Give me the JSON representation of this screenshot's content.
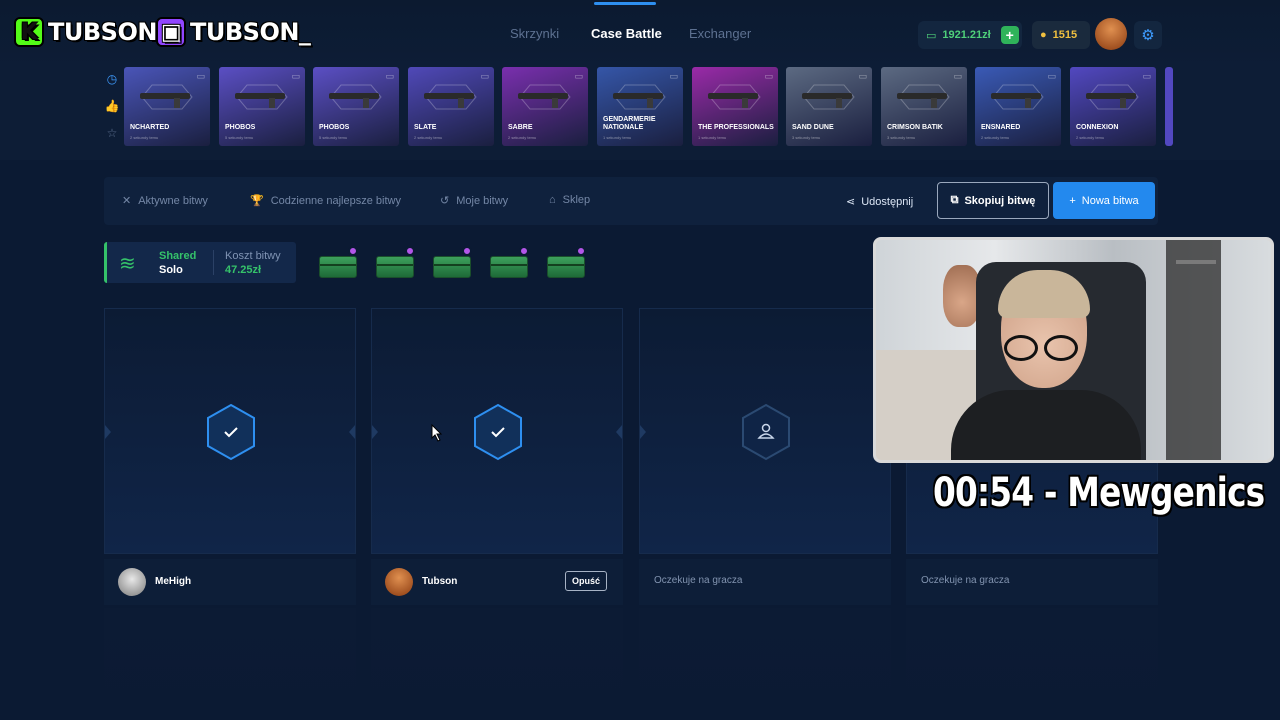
{
  "overlay": {
    "kick_handle": "TUBSON",
    "twitch_handle": "TUBSON_",
    "timer_text": "00:54 - Mewgenics"
  },
  "header": {
    "nav": [
      {
        "label": "Skrzynki",
        "active": false
      },
      {
        "label": "Case Battle",
        "active": true
      },
      {
        "label": "Exchanger",
        "active": false
      }
    ],
    "balance": "1921.21zł",
    "coins": "1515",
    "icons": {
      "wallet": "wallet-icon",
      "add": "plus-icon",
      "coin": "coin-icon",
      "settings": "gear-icon"
    }
  },
  "drops": {
    "filter_icons": [
      "clock-icon",
      "thumbs-up-icon",
      "star-icon"
    ],
    "items": [
      {
        "name": "NCHARTED",
        "sub": "2 sekundy temu",
        "color": "#4a55b8"
      },
      {
        "name": "PHOBOS",
        "sub": "5 sekundy temu",
        "color": "#5b4fc4"
      },
      {
        "name": "PHOBOS",
        "sub": "5 sekundy temu",
        "color": "#5b4fc4"
      },
      {
        "name": "SLATE",
        "sub": "2 sekundy temu",
        "color": "#5049b8"
      },
      {
        "name": "SABRE",
        "sub": "2 sekundy temu",
        "color": "#7a2fae"
      },
      {
        "name": "GENDARMERIE NATIONALE",
        "sub": "1 sekundy temu",
        "color": "#3556a8"
      },
      {
        "name": "THE PROFESSIONALS",
        "sub": "1 sekundy temu",
        "color": "#9a2aa8"
      },
      {
        "name": "SAND DUNE",
        "sub": "3 sekundy temu",
        "color": "#5c6a82"
      },
      {
        "name": "CRIMSON BATIK",
        "sub": "3 sekundy temu",
        "color": "#5c6a82"
      },
      {
        "name": "ENSNARED",
        "sub": "2 sekundy temu",
        "color": "#3a5ab6"
      },
      {
        "name": "CONNEXION",
        "sub": "2 sekundy temu",
        "color": "#5248c0"
      }
    ]
  },
  "filterbar": {
    "tabs": [
      {
        "label": "Aktywne bitwy",
        "icon": "swords-icon"
      },
      {
        "label": "Codzienne najlepsze bitwy",
        "icon": "trophy-icon"
      },
      {
        "label": "Moje bitwy",
        "icon": "history-icon"
      },
      {
        "label": "Sklep",
        "icon": "basket-icon"
      }
    ],
    "share_label": "Udostępnij",
    "copy_label": "Skopiuj bitwę",
    "new_label": "Nowa bitwa"
  },
  "battle": {
    "mode_line1": "Shared",
    "mode_line2": "Solo",
    "cost_label": "Koszt bitwy",
    "cost_value": "47.25zł",
    "case_count": 5
  },
  "players": [
    {
      "state": "ready",
      "name": "MeHigh",
      "wait": "",
      "leave": ""
    },
    {
      "state": "ready",
      "name": "Tubson",
      "wait": "",
      "leave": "Opuść"
    },
    {
      "state": "empty",
      "name": "",
      "wait": "Oczekuje na gracza",
      "leave": ""
    },
    {
      "state": "empty",
      "name": "",
      "wait": "Oczekuje na gracza",
      "leave": ""
    }
  ],
  "colors": {
    "background": "#0b1a33",
    "accent_blue": "#2389ee",
    "accent_green": "#35c26a",
    "hex_active": "#2e8ff0",
    "hex_idle": "#2b4a72"
  }
}
